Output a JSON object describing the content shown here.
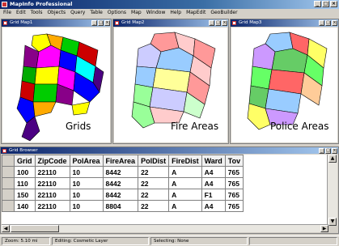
{
  "app": {
    "title": "MapInfo Professional"
  },
  "menu": [
    "File",
    "Edit",
    "Tools",
    "Objects",
    "Query",
    "Table",
    "Options",
    "Map",
    "Window",
    "Help",
    "MapEdit",
    "GeoBuilder"
  ],
  "windows": [
    {
      "title": "Grid Map1",
      "label": "Grids"
    },
    {
      "title": "Grid Map2",
      "label": "Fire Areas"
    },
    {
      "title": "Grid Map3",
      "label": "Police Areas"
    }
  ],
  "browser": {
    "title": "Grid Browser",
    "columns": [
      "Grid",
      "ZipCode",
      "PolArea",
      "FireArea",
      "PolDist",
      "FireDist",
      "Ward",
      "Tov"
    ],
    "rows": [
      [
        "100",
        "22110",
        "10",
        "8442",
        "22",
        "A",
        "A4",
        "765"
      ],
      [
        "110",
        "22110",
        "10",
        "8442",
        "22",
        "A",
        "A4",
        "765"
      ],
      [
        "150",
        "22110",
        "10",
        "8442",
        "22",
        "A",
        "F1",
        "765"
      ],
      [
        "140",
        "22110",
        "10",
        "8804",
        "22",
        "A",
        "A4",
        "765"
      ]
    ]
  },
  "status": {
    "zoom": "Zoom: 5.10 mi",
    "editing": "Editing: Cosmetic Layer",
    "selecting": "Selecting: None"
  },
  "colors": {
    "title_bar": "#0a246a",
    "grids_palette": [
      "#f0f",
      "#0c0",
      "#00f",
      "#ff0",
      "#0ff",
      "#808",
      "#4b0082",
      "#fa0",
      "#0a0",
      "#c00"
    ],
    "fire_palette": [
      "#f99",
      "#9cf",
      "#9f9",
      "#ccf",
      "#ff9",
      "#fcc",
      "#cfc",
      "#ddd"
    ],
    "police_palette": [
      "#f66",
      "#6c6",
      "#9cf",
      "#ff6",
      "#c9f",
      "#6f6",
      "#fc9"
    ]
  }
}
